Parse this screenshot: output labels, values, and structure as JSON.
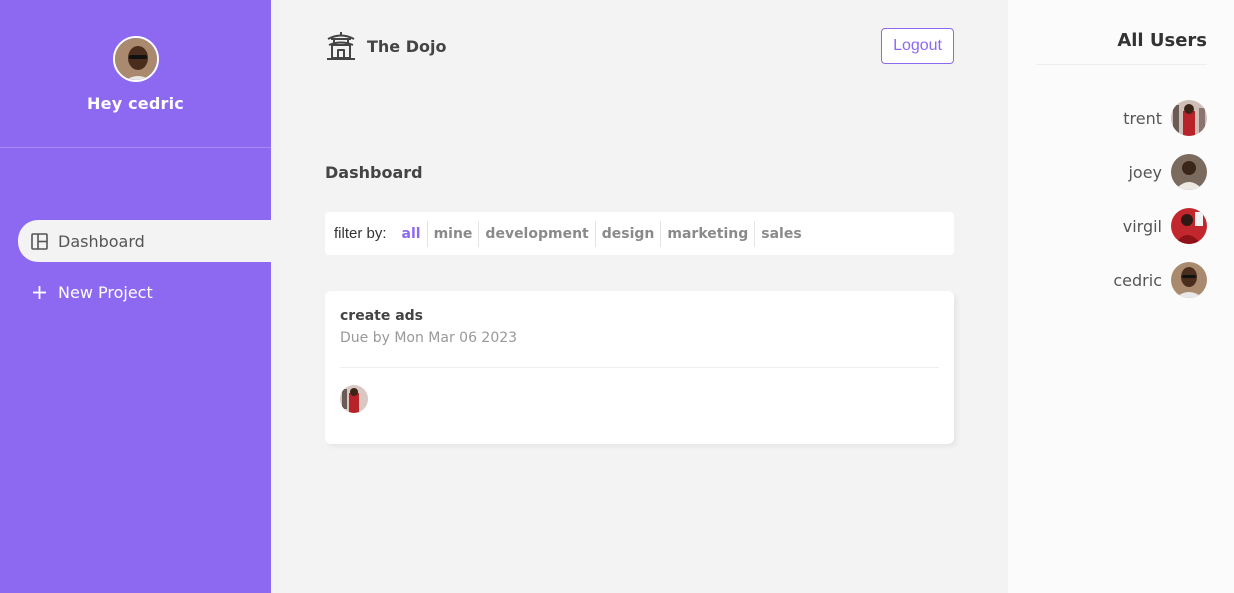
{
  "sidebar": {
    "greeting": "Hey cedric",
    "nav": [
      {
        "label": "Dashboard",
        "icon": "dashboard-icon",
        "active": true
      },
      {
        "label": "New Project",
        "icon": "plus-icon",
        "active": false
      }
    ]
  },
  "navbar": {
    "brand": "The Dojo",
    "logo_icon": "temple-icon",
    "logout_label": "Logout"
  },
  "page": {
    "title": "Dashboard"
  },
  "filter": {
    "label": "filter by:",
    "options": [
      "all",
      "mine",
      "development",
      "design",
      "marketing",
      "sales"
    ],
    "active": "all"
  },
  "projects": [
    {
      "name": "create ads",
      "due": "Due by Mon Mar 06 2023"
    }
  ],
  "users_panel": {
    "title": "All Users",
    "users": [
      "trent",
      "joey",
      "virgil",
      "cedric"
    ]
  },
  "colors": {
    "primary": "#8d69f1",
    "background": "#f3f3f3"
  }
}
